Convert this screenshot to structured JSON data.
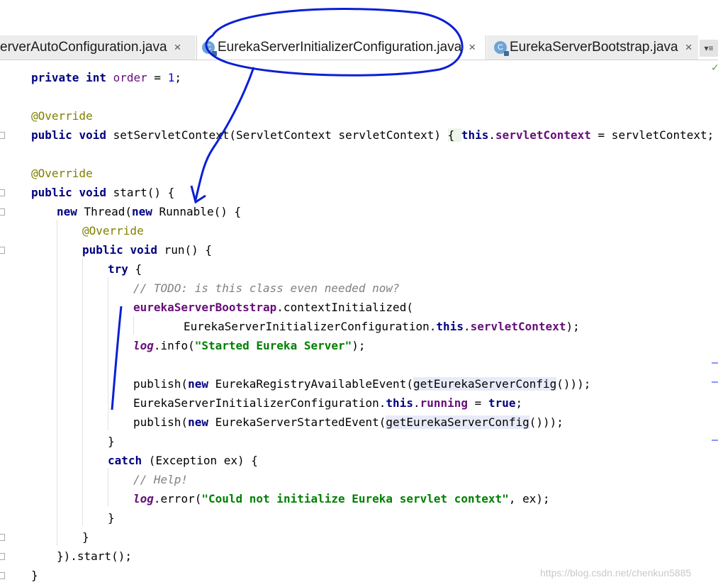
{
  "tabs": [
    {
      "label": "erverAutoConfiguration.java",
      "close": "×"
    },
    {
      "label": "EurekaServerInitializerConfiguration.java",
      "close": "×",
      "icon": "class-icon",
      "icon_letter": "C"
    },
    {
      "label": "EurekaServerBootstrap.java",
      "close": "×",
      "icon": "class-icon",
      "icon_letter": "C"
    }
  ],
  "tab_overflow_label": "▾≡",
  "code": {
    "l1": {
      "kw1": "private",
      "kw2": "int",
      "field": "order",
      "op": " = ",
      "num": "1",
      "end": ";"
    },
    "l2": {
      "ann": "@Override"
    },
    "l3": {
      "kw1": "public",
      "kw2": "void",
      "name": " setServletContext(ServletContext servletContext) ",
      "brace_open": "{ ",
      "this": "this",
      "dot": ".",
      "field": "servletContext",
      "rest": " = servletContext; ",
      "brace_close": "}"
    },
    "l4": {
      "ann": "@Override"
    },
    "l5": {
      "kw1": "public",
      "kw2": "void",
      "rest": " start() {"
    },
    "l6": {
      "kw1": "new",
      "mid": " Thread(",
      "kw2": "new",
      "rest": " Runnable() {"
    },
    "l7": {
      "ann": "@Override"
    },
    "l8": {
      "kw1": "public",
      "kw2": "void",
      "rest": " run() {"
    },
    "l9": {
      "kw": "try",
      "rest": " {"
    },
    "l10": {
      "cmt": "// TODO: is this class even needed now?"
    },
    "l11": {
      "field": "eurekaServerBootstrap",
      "rest": ".contextInitialized("
    },
    "l12": {
      "pre": "EurekaServerInitializerConfiguration.",
      "this": "this",
      "dot": ".",
      "field": "servletContext",
      "rest": ");"
    },
    "l13": {
      "static": "log",
      "mid": ".info(",
      "str": "\"Started Eureka Server\"",
      "rest": ");"
    },
    "l14": {
      "pre": "publish(",
      "kw": "new",
      "mid": " EurekaRegistryAvailableEvent(",
      "hl": "getEurekaServerConfig",
      "rest": "()));"
    },
    "l15": {
      "pre": "EurekaServerInitializerConfiguration.",
      "this": "this",
      "dot": ".",
      "field": "running",
      "op": " = ",
      "kw": "true",
      "end": ";"
    },
    "l16": {
      "pre": "publish(",
      "kw": "new",
      "mid": " EurekaServerStartedEvent(",
      "hl": "getEurekaServerConfig",
      "rest": "()));"
    },
    "l17": {
      "text": "}"
    },
    "l18": {
      "kw": "catch",
      "rest": " (Exception ex) {"
    },
    "l19": {
      "cmt": "// Help!"
    },
    "l20": {
      "static": "log",
      "mid": ".error(",
      "str": "\"Could not initialize Eureka servlet context\"",
      "rest": ", ex);"
    },
    "l21": {
      "text": "}"
    },
    "l22": {
      "text": "}"
    },
    "l23": {
      "text": "}).start();"
    },
    "l24": {
      "text": "}"
    }
  },
  "watermark": "https://blog.csdn.net/chenkun5885",
  "annotation_color": "#0a1fd6"
}
